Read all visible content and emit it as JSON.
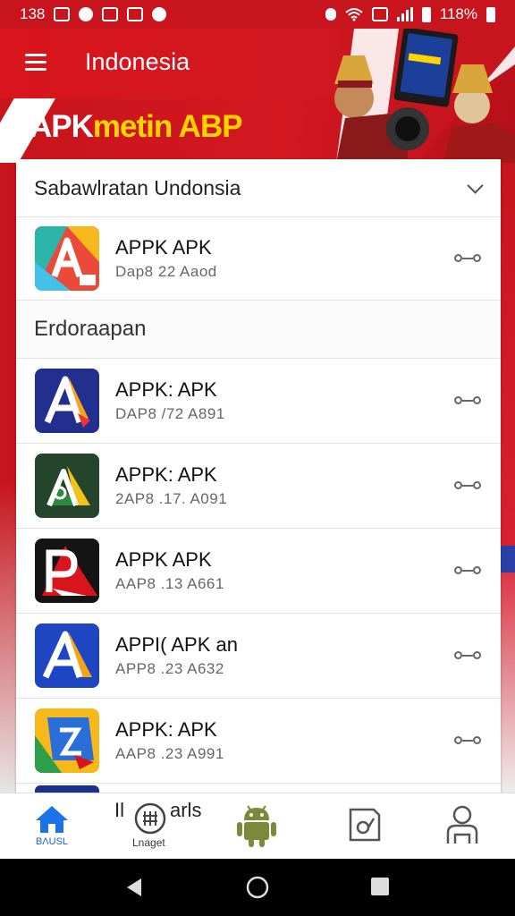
{
  "status_bar": {
    "time": "138",
    "battery_text": "118%"
  },
  "app_bar": {
    "title": "Indonesia"
  },
  "banner": {
    "title_part1": "APK",
    "title_part2": "metin ABP"
  },
  "section": {
    "header": "Sabawlratan Undonsia",
    "first_item": {
      "title": "APPK APK",
      "subtitle": "Dap8 22 Aaod"
    },
    "subheader": "Erdoraapan",
    "items": [
      {
        "title": "APPK: APK",
        "subtitle": "DAP8 /72 A891"
      },
      {
        "title": "APPK: APK",
        "subtitle": "2AP8 .17. A091"
      },
      {
        "title": "APPK APK",
        "subtitle": "AAP8 .13 A661"
      },
      {
        "title": "APPI( APK an",
        "subtitle": "APP8 .23 A632"
      },
      {
        "title": "APPK: APK",
        "subtitle": "AAP8 .23 A991"
      }
    ]
  },
  "bottom_nav": {
    "home_label": "ΒΛUSL",
    "caption": "Il",
    "caption_right": "arls",
    "sublabel": "Lnaget"
  },
  "colors": {
    "brand_red": "#c8141c",
    "accent_yellow": "#ffd400",
    "nav_active": "#1a5fd0",
    "android_green": "#7a8a3a"
  }
}
